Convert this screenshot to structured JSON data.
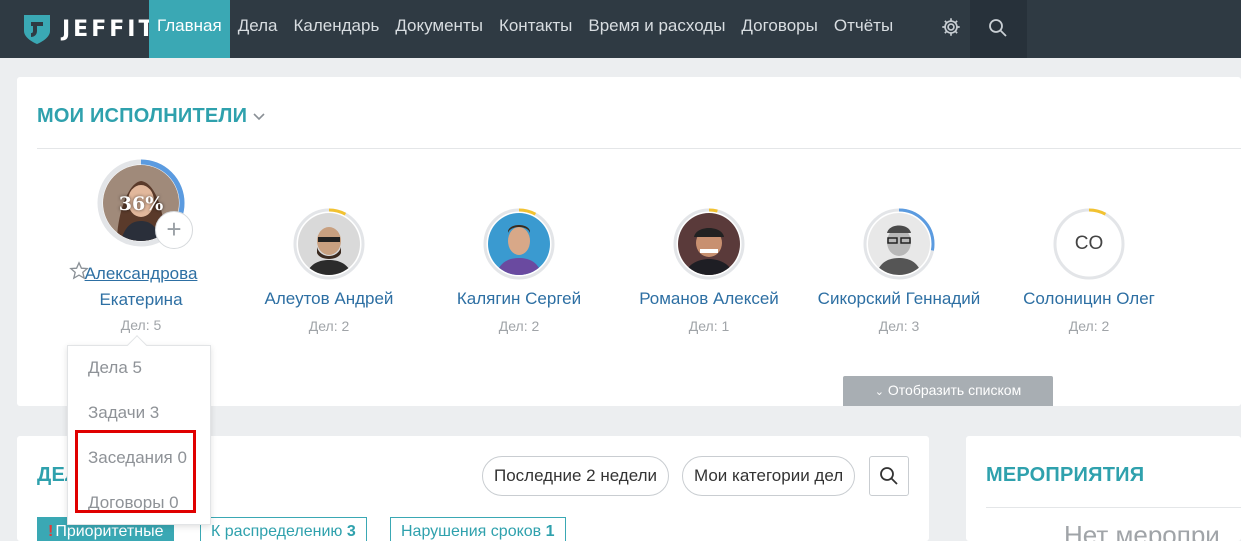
{
  "app": {
    "logo_text": "JEFFIT"
  },
  "nav": {
    "items": [
      {
        "label": "Главная",
        "active": true
      },
      {
        "label": "Дела"
      },
      {
        "label": "Календарь"
      },
      {
        "label": "Документы"
      },
      {
        "label": "Контакты"
      },
      {
        "label": "Время и расходы"
      },
      {
        "label": "Договоры"
      },
      {
        "label": "Отчёты"
      }
    ],
    "settings_icon": "gear-icon",
    "search_icon": "search-icon"
  },
  "performers": {
    "title": "МОИ ИСПОЛНИТЕЛИ",
    "main": {
      "name_line1": "Александрова",
      "name_line2": "Екатерина",
      "progress_label": "36%",
      "progress": 0.36,
      "count_label": "Дел: 5"
    },
    "list": [
      {
        "name": "Алеутов Андрей",
        "count_label": "Дел: 2",
        "progress": 0.08
      },
      {
        "name": "Калягин Сергей",
        "count_label": "Дел: 2",
        "progress": 0.08
      },
      {
        "name": "Романов Алексей",
        "count_label": "Дел: 1",
        "progress": 0.04
      },
      {
        "name": "Сикорский Геннадий",
        "count_label": "Дел: 3",
        "progress": 0.28
      },
      {
        "name": "Солоницин Олег",
        "count_label": "Дел: 2",
        "progress": 0.08,
        "initials": "CO"
      }
    ],
    "show_list_label": "Отобразить списком",
    "colors": {
      "progress_blue": "#5b9be0",
      "progress_yellow": "#f2c230",
      "ring_grey": "#e3e5e8"
    }
  },
  "dropdown": {
    "items": [
      {
        "label": "Дела 5"
      },
      {
        "label": "Задачи 3"
      },
      {
        "label": "Заседания 0"
      },
      {
        "label": "Договоры 0"
      }
    ]
  },
  "cases": {
    "title": "ДЕЛА",
    "period_filter": "Последние 2 недели",
    "category_filter": "Мои категории дел",
    "tabs": [
      {
        "label": "Приоритетные",
        "count": "",
        "active": true
      },
      {
        "label": "К распределению",
        "count": "3"
      },
      {
        "label": "Нарушения сроков",
        "count": "1"
      }
    ]
  },
  "events": {
    "title": "МЕРОПРИЯТИЯ",
    "empty_text": "Нет меропри"
  },
  "theme": {
    "accent": "#3aa8b4",
    "nav_bg": "#2f3a43",
    "highlight": "#e00000"
  }
}
